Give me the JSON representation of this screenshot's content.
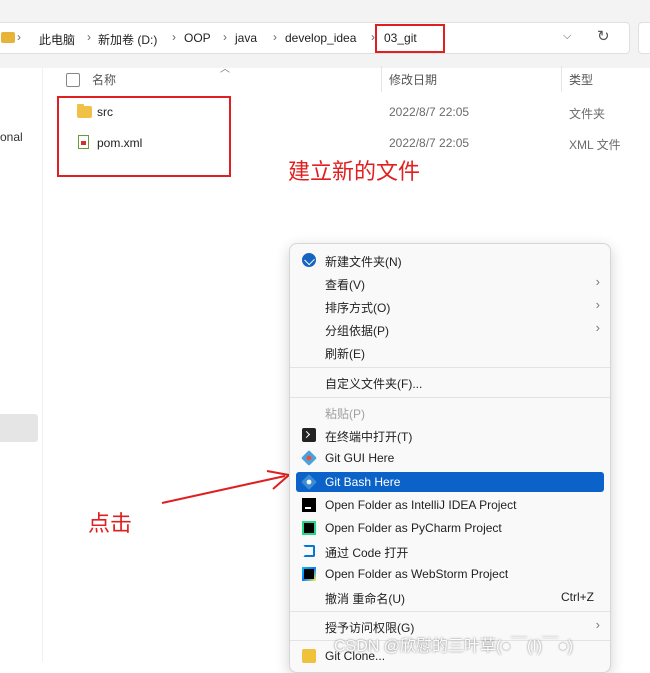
{
  "address_bar": {
    "breadcrumbs": [
      "此电脑",
      "新加卷 (D:)",
      "OOP",
      "java",
      "develop_idea",
      "03_git"
    ],
    "dropdown_icon": "chevron-down-icon",
    "refresh_icon": "refresh-icon"
  },
  "nav_pane": {
    "partial_item": "onal"
  },
  "columns": {
    "name": "名称",
    "date": "修改日期",
    "type": "类型"
  },
  "files": [
    {
      "name": "src",
      "date": "2022/8/7 22:05",
      "type": "文件夹",
      "icon": "folder-icon"
    },
    {
      "name": "pom.xml",
      "date": "2022/8/7 22:05",
      "type": "XML 文件",
      "icon": "xml-file-icon"
    }
  ],
  "annotations": {
    "create_files": "建立新的文件",
    "click": "点击",
    "highlight_color": "#e02020"
  },
  "context_menu": {
    "items": [
      {
        "label": "新建文件夹(N)",
        "icon": "new-folder-icon"
      },
      {
        "label": "查看(V)",
        "submenu": true
      },
      {
        "label": "排序方式(O)",
        "submenu": true
      },
      {
        "label": "分组依据(P)",
        "submenu": true
      },
      {
        "label": "刷新(E)"
      },
      {
        "label": "自定义文件夹(F)..."
      },
      {
        "label": "粘贴(P)",
        "disabled": true
      },
      {
        "label": "在终端中打开(T)",
        "icon": "terminal-icon"
      },
      {
        "label": "Git GUI Here",
        "icon": "git-gui-icon"
      },
      {
        "label": "Git Bash Here",
        "icon": "git-bash-icon",
        "selected": true
      },
      {
        "label": "Open Folder as IntelliJ IDEA Project",
        "icon": "intellij-idea-icon"
      },
      {
        "label": "Open Folder as PyCharm Project",
        "icon": "pycharm-icon"
      },
      {
        "label": "通过 Code 打开",
        "icon": "vscode-icon"
      },
      {
        "label": "Open Folder as WebStorm Project",
        "icon": "webstorm-icon"
      },
      {
        "label": "撤消 重命名(U)",
        "accelerator": "Ctrl+Z"
      },
      {
        "label": "授予访问权限(G)",
        "submenu": true
      },
      {
        "label": "Git Clone...",
        "icon": "git-clone-icon"
      }
    ],
    "selected_color": "#0b63c9"
  },
  "watermark": "CSDN @欣慰的三叶草(●￣(I)￣●)"
}
